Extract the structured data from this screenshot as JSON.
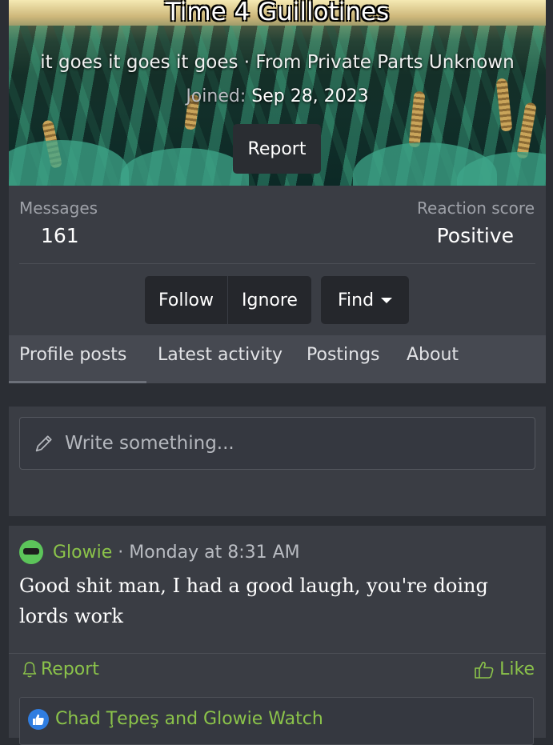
{
  "profile": {
    "username": "Time 4 Guillotines",
    "tagline": "it goes it goes it goes · From Private Parts Unknown",
    "joined_label": "Joined:",
    "joined_date": "Sep 28, 2023",
    "report_label": "Report"
  },
  "stats": {
    "messages_label": "Messages",
    "messages_value": "161",
    "reaction_label": "Reaction score",
    "reaction_value": "Positive"
  },
  "actions": {
    "follow": "Follow",
    "ignore": "Ignore",
    "find": "Find"
  },
  "tabs": [
    "Profile posts",
    "Latest activity",
    "Postings",
    "About"
  ],
  "composer": {
    "placeholder": "Write something..."
  },
  "post": {
    "author": "Glowie",
    "separator": "·",
    "time": "Monday at 8:31 AM",
    "body": "Good shit man, I had a good laugh, you're doing lords work",
    "report": "Report",
    "like": "Like",
    "reactions": "Chad Ţepeş and Glowie Watch"
  },
  "colors": {
    "accent_green": "#8bc34a",
    "panel": "#3a3d44",
    "background": "#2b2e34"
  }
}
